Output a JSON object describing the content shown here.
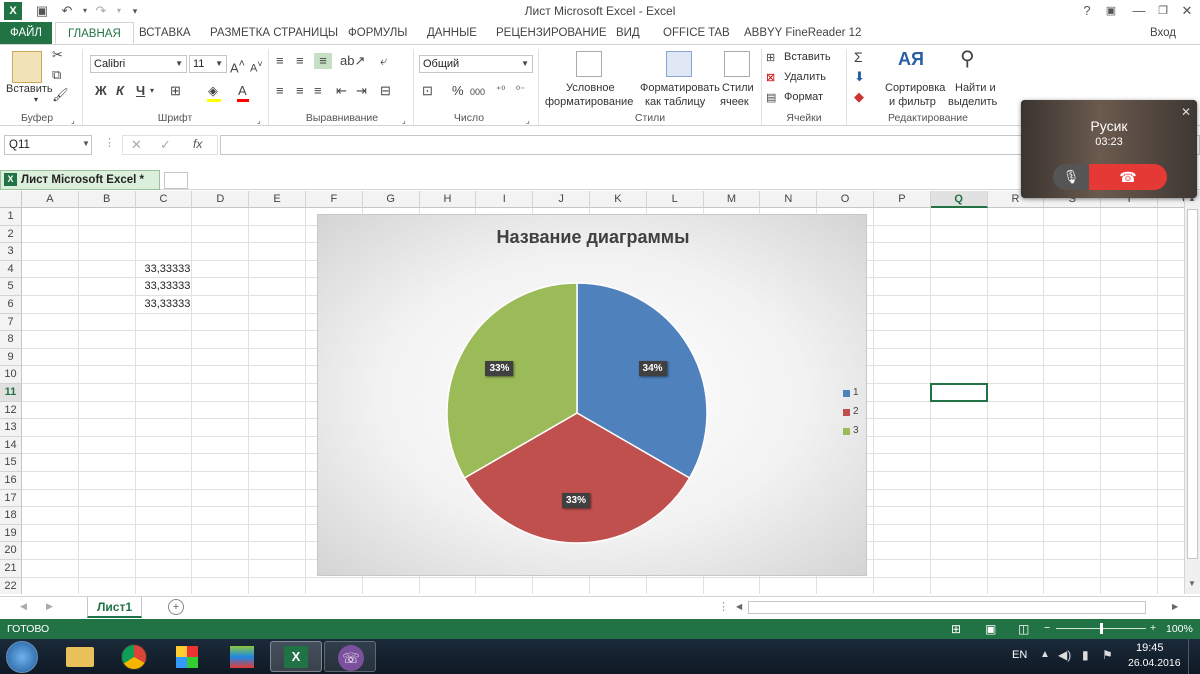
{
  "window": {
    "title": "Лист Microsoft Excel - Excel",
    "help": "?",
    "login": "Вход"
  },
  "tabs": {
    "file": "ФАЙЛ",
    "home": "ГЛАВНАЯ",
    "insert": "ВСТАВКА",
    "layout": "РАЗМЕТКА СТРАНИЦЫ",
    "formulas": "ФОРМУЛЫ",
    "data": "ДАННЫЕ",
    "review": "РЕЦЕНЗИРОВАНИЕ",
    "view": "ВИД",
    "officetab": "OFFICE TAB",
    "abbyy": "ABBYY FineReader 12"
  },
  "ribbon": {
    "paste": "Вставить",
    "clipboard": "Буфер обмена",
    "font_name": "Calibri",
    "font_size": "11",
    "bold": "Ж",
    "italic": "К",
    "underline": "Ч",
    "font_group": "Шрифт",
    "align_group": "Выравнивание",
    "number_format": "Общий",
    "number_group": "Число",
    "cond_format_1": "Условное",
    "cond_format_2": "форматирование",
    "format_table_1": "Форматировать",
    "format_table_2": "как таблицу",
    "cell_styles_1": "Стили",
    "cell_styles_2": "ячеек",
    "styles_group": "Стили",
    "insert_cells": "Вставить",
    "delete_cells": "Удалить",
    "format_cells": "Формат",
    "cells_group": "Ячейки",
    "sort_1": "Сортировка",
    "sort_2": "и фильтр",
    "find_1": "Найти и",
    "find_2": "выделить",
    "edit_group": "Редактирование",
    "percent": "%",
    "thousands": "000"
  },
  "formula_bar": {
    "name_box": "Q11",
    "fx": "fx",
    "value": ""
  },
  "doc_tab": {
    "label": "Лист Microsoft Excel *"
  },
  "grid": {
    "columns": [
      "A",
      "B",
      "C",
      "D",
      "E",
      "F",
      "G",
      "H",
      "I",
      "J",
      "K",
      "L",
      "M",
      "N",
      "O",
      "P",
      "Q",
      "R",
      "S",
      "T",
      "U"
    ],
    "rows": [
      "1",
      "2",
      "3",
      "4",
      "5",
      "6",
      "7",
      "8",
      "9",
      "10",
      "11",
      "12",
      "13",
      "14",
      "15",
      "16",
      "17",
      "18",
      "19",
      "20",
      "21",
      "22"
    ],
    "selected_column": "Q",
    "selected_row": "11",
    "cells": [
      {
        "ref": "C4",
        "value": "33,33333"
      },
      {
        "ref": "C5",
        "value": "33,33333"
      },
      {
        "ref": "C6",
        "value": "33,33333"
      }
    ]
  },
  "chart_data": {
    "type": "pie",
    "title": "Название диаграммы",
    "categories": [
      "1",
      "2",
      "3"
    ],
    "values": [
      33.33333,
      33.33333,
      33.33333
    ],
    "data_labels": [
      "34%",
      "33%",
      "33%"
    ],
    "colors": [
      "#4f81bd",
      "#c0504d",
      "#9bbb59"
    ],
    "legend": "right"
  },
  "sheets": {
    "active": "Лист1"
  },
  "status": {
    "ready": "ГОТОВО",
    "zoom": "100%",
    "zoom_fraction": 0.5
  },
  "taskbar": {
    "lang": "EN",
    "time": "19:45",
    "date": "26.04.2016"
  },
  "call": {
    "name": "Русик",
    "duration": "03:23"
  }
}
